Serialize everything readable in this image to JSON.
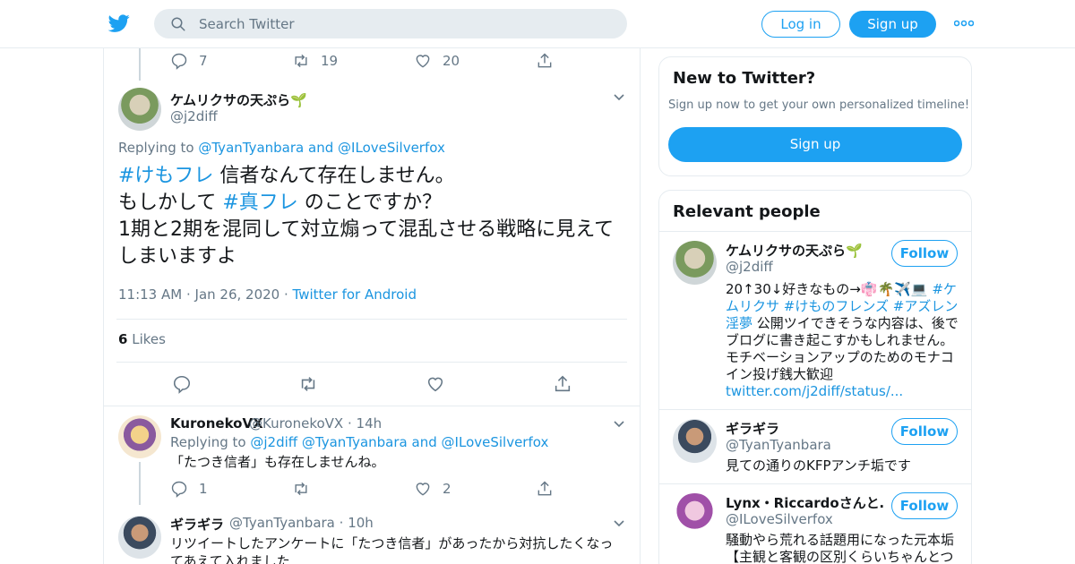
{
  "header": {
    "search_placeholder": "Search Twitter",
    "login_label": "Log in",
    "signup_label": "Sign up",
    "brand_color": "#1da1f2"
  },
  "prev_tweet": {
    "reply_count": "7",
    "retweet_count": "19",
    "like_count": "20"
  },
  "main_tweet": {
    "name": "ケムリクサの天ぷら🌱",
    "handle": "@j2diff",
    "replying_prefix": "Replying to",
    "reply_user1": "@TyanTyanbara",
    "reply_and": "and",
    "reply_user2": "@ILoveSilverfox",
    "hashtag1": "#けもフレ",
    "line1_rest": " 信者なんて存在しません。",
    "line2_pre": "もしかして ",
    "hashtag2": "#真フレ",
    "line2_rest": " のことですか？",
    "line3": "1期と2期を混同して対立煽って混乱させる戦略に見えてしまいますよ",
    "time": "11:13 AM",
    "date": "Jan 26, 2020",
    "source": "Twitter for Android",
    "likes_count": "6",
    "likes_label": "Likes"
  },
  "reply1": {
    "name": "KuronekoVX",
    "handle": "@KuronekoVX",
    "age": "14h",
    "replying_prefix": "Replying to",
    "reply_users": "@j2diff @TyanTyanbara",
    "reply_and": "and",
    "reply_user_last": "@ILoveSilverfox",
    "text": "「たつき信者」も存在しませんね。",
    "reply_count": "1",
    "like_count": "2"
  },
  "reply2": {
    "name": "ギラギラ",
    "handle": "@TyanTyanbara",
    "age": "10h",
    "text": "リツイートしたアンケートに「たつき信者」があったから対抗したくなってあえて入れました"
  },
  "sidebar": {
    "new_title": "New to Twitter?",
    "new_sub": "Sign up now to get your own personalized timeline!",
    "new_signup": "Sign up",
    "relevant_title": "Relevant people",
    "follow_label": "Follow",
    "people": [
      {
        "name": "ケムリクサの天ぷら🌱",
        "handle": "@j2diff",
        "bio_pre": "20↑30↓好きなもの→👘🌴✈️💻 ",
        "bio_tags": "#ケムリクサ #けものフレンズ #アズレン 淫夢",
        "bio_rest": " 公開ツイできそうな内容は、後でブログに書き起こすかもしれません。 モチベーションアップのためのモナコイン投げ銭大歓迎",
        "bio_link": "twitter.com/j2diff/status/..."
      },
      {
        "name": "ギラギラ",
        "handle": "@TyanTyanbara",
        "bio": "見ての通りのKFPアンチ垢です"
      },
      {
        "name": "Lynx・Riccardoさんと…",
        "handle": "@ILoveSilverfox",
        "bio": "騒動やら荒れる話題用になった元本垢【主観と客観の区別くらいちゃんとつ"
      }
    ]
  }
}
